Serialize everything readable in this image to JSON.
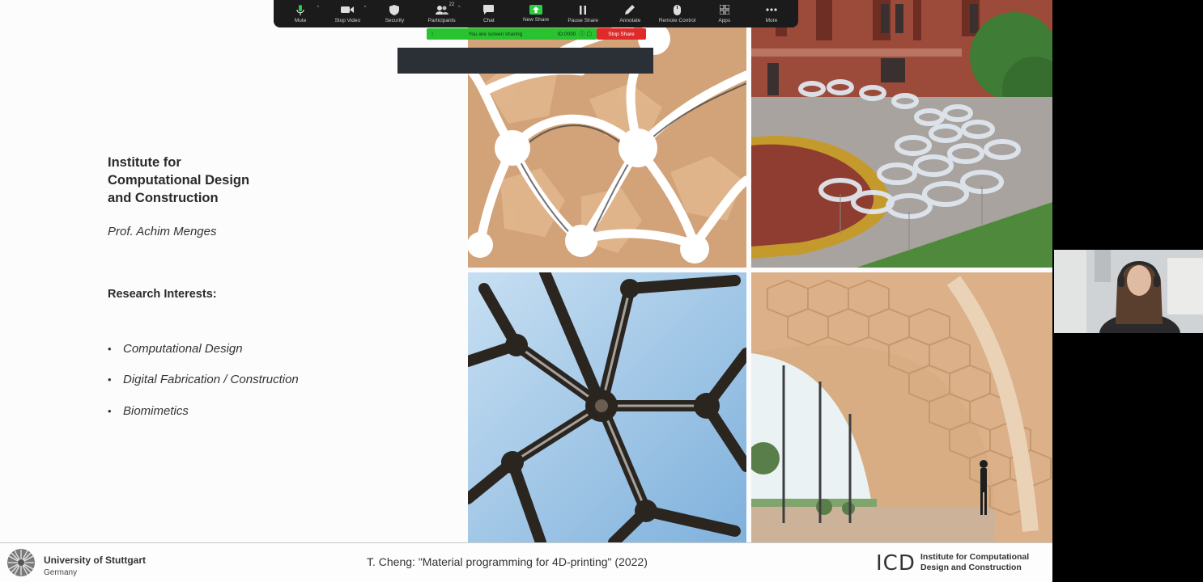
{
  "slide": {
    "institute_title": "Institute for\nComputational Design\nand Construction",
    "professor": "Prof. Achim Menges",
    "research_heading": "Research Interests:",
    "interests": [
      "Computational Design",
      "Digital Fabrication / Construction",
      "Biomimetics"
    ]
  },
  "footer": {
    "university": "University of Stuttgart",
    "country": "Germany",
    "citation": "T. Cheng: \"Material programming for 4D-printing\" (2022)",
    "icd_logo": "ICD",
    "icd_name": "Institute for Computational\nDesign and Construction"
  },
  "zoom_toolbar": {
    "items": [
      {
        "label": "Mute",
        "icon": "microphone-icon"
      },
      {
        "label": "Stop Video",
        "icon": "video-camera-icon"
      },
      {
        "label": "Security",
        "icon": "shield-icon"
      },
      {
        "label": "Participants",
        "icon": "participants-icon",
        "badge": "22"
      },
      {
        "label": "Chat",
        "icon": "chat-icon"
      },
      {
        "label": "New Share",
        "icon": "share-screen-icon"
      },
      {
        "label": "Pause Share",
        "icon": "pause-icon"
      },
      {
        "label": "Annotate",
        "icon": "pen-icon"
      },
      {
        "label": "Remote Control",
        "icon": "mouse-icon"
      },
      {
        "label": "Apps",
        "icon": "apps-icon"
      },
      {
        "label": "More",
        "icon": "more-icon"
      }
    ]
  },
  "sharing": {
    "status_text": "You are screen sharing",
    "meeting_id": "ID:0000",
    "stop_label": "Stop Share"
  },
  "colors": {
    "toolbar_bg": "#1b1b1b",
    "sharing_green": "#29c332",
    "stop_red": "#e02a2a"
  }
}
